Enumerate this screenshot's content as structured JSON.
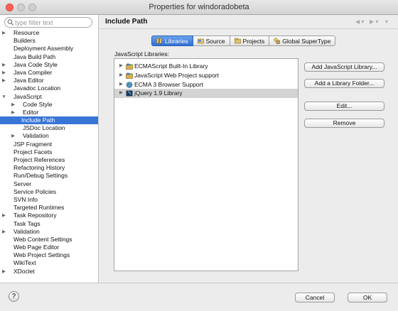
{
  "window": {
    "title": "Properties for windoradobeta"
  },
  "filter": {
    "placeholder": "type filter text"
  },
  "tree": [
    {
      "label": "Resource",
      "expander": "▶",
      "level": 0
    },
    {
      "label": "Builders",
      "expander": "",
      "level": 0
    },
    {
      "label": "Deployment Assembly",
      "expander": "",
      "level": 0
    },
    {
      "label": "Java Build Path",
      "expander": "",
      "level": 0
    },
    {
      "label": "Java Code Style",
      "expander": "▶",
      "level": 0
    },
    {
      "label": "Java Compiler",
      "expander": "▶",
      "level": 0
    },
    {
      "label": "Java Editor",
      "expander": "▶",
      "level": 0
    },
    {
      "label": "Javadoc Location",
      "expander": "",
      "level": 0
    },
    {
      "label": "JavaScript",
      "expander": "▼",
      "level": 0
    },
    {
      "label": "Code Style",
      "expander": "▶",
      "level": 1
    },
    {
      "label": "Editor",
      "expander": "▶",
      "level": 1
    },
    {
      "label": "Include Path",
      "expander": "",
      "level": 1,
      "selected": true
    },
    {
      "label": "JSDoc Location",
      "expander": "",
      "level": 1
    },
    {
      "label": "Validation",
      "expander": "▶",
      "level": 1
    },
    {
      "label": "JSP Fragment",
      "expander": "",
      "level": 0
    },
    {
      "label": "Project Facets",
      "expander": "",
      "level": 0
    },
    {
      "label": "Project References",
      "expander": "",
      "level": 0
    },
    {
      "label": "Refactoring History",
      "expander": "",
      "level": 0
    },
    {
      "label": "Run/Debug Settings",
      "expander": "",
      "level": 0
    },
    {
      "label": "Server",
      "expander": "",
      "level": 0
    },
    {
      "label": "Service Policies",
      "expander": "",
      "level": 0
    },
    {
      "label": "SVN Info",
      "expander": "",
      "level": 0
    },
    {
      "label": "Targeted Runtimes",
      "expander": "",
      "level": 0
    },
    {
      "label": "Task Repository",
      "expander": "▶",
      "level": 0
    },
    {
      "label": "Task Tags",
      "expander": "",
      "level": 0
    },
    {
      "label": "Validation",
      "expander": "▶",
      "level": 0
    },
    {
      "label": "Web Content Settings",
      "expander": "",
      "level": 0
    },
    {
      "label": "Web Page Editor",
      "expander": "",
      "level": 0
    },
    {
      "label": "Web Project Settings",
      "expander": "",
      "level": 0
    },
    {
      "label": "WikiText",
      "expander": "",
      "level": 0
    },
    {
      "label": "XDoclet",
      "expander": "▶",
      "level": 0
    }
  ],
  "header": {
    "title": "Include Path"
  },
  "tabs": [
    {
      "label": "Libraries",
      "icon": "libraries-icon",
      "active": true
    },
    {
      "label": "Source",
      "icon": "source-icon",
      "active": false
    },
    {
      "label": "Projects",
      "icon": "projects-icon",
      "active": false
    },
    {
      "label": "Global SuperType",
      "icon": "supertype-icon",
      "active": false
    }
  ],
  "libraries": {
    "label": "JavaScript Libraries:",
    "items": [
      {
        "label": "ECMAScript Built-In Library",
        "icon": "library-jar-icon"
      },
      {
        "label": "JavaScript Web Project support",
        "icon": "library-jar-icon"
      },
      {
        "label": "ECMA 3 Browser Support",
        "icon": "globe-icon"
      },
      {
        "label": "jQuery 1.9 Library",
        "icon": "jquery-icon",
        "selected": true
      }
    ]
  },
  "buttons": {
    "add_js_library": "Add JavaScript Library...",
    "add_library_folder": "Add a Library Folder...",
    "edit": "Edit...",
    "remove": "Remove"
  },
  "footer": {
    "help": "?",
    "cancel": "Cancel",
    "ok": "OK"
  },
  "colors": {
    "selection": "#3875d7",
    "accent": "#2f6fd4"
  }
}
